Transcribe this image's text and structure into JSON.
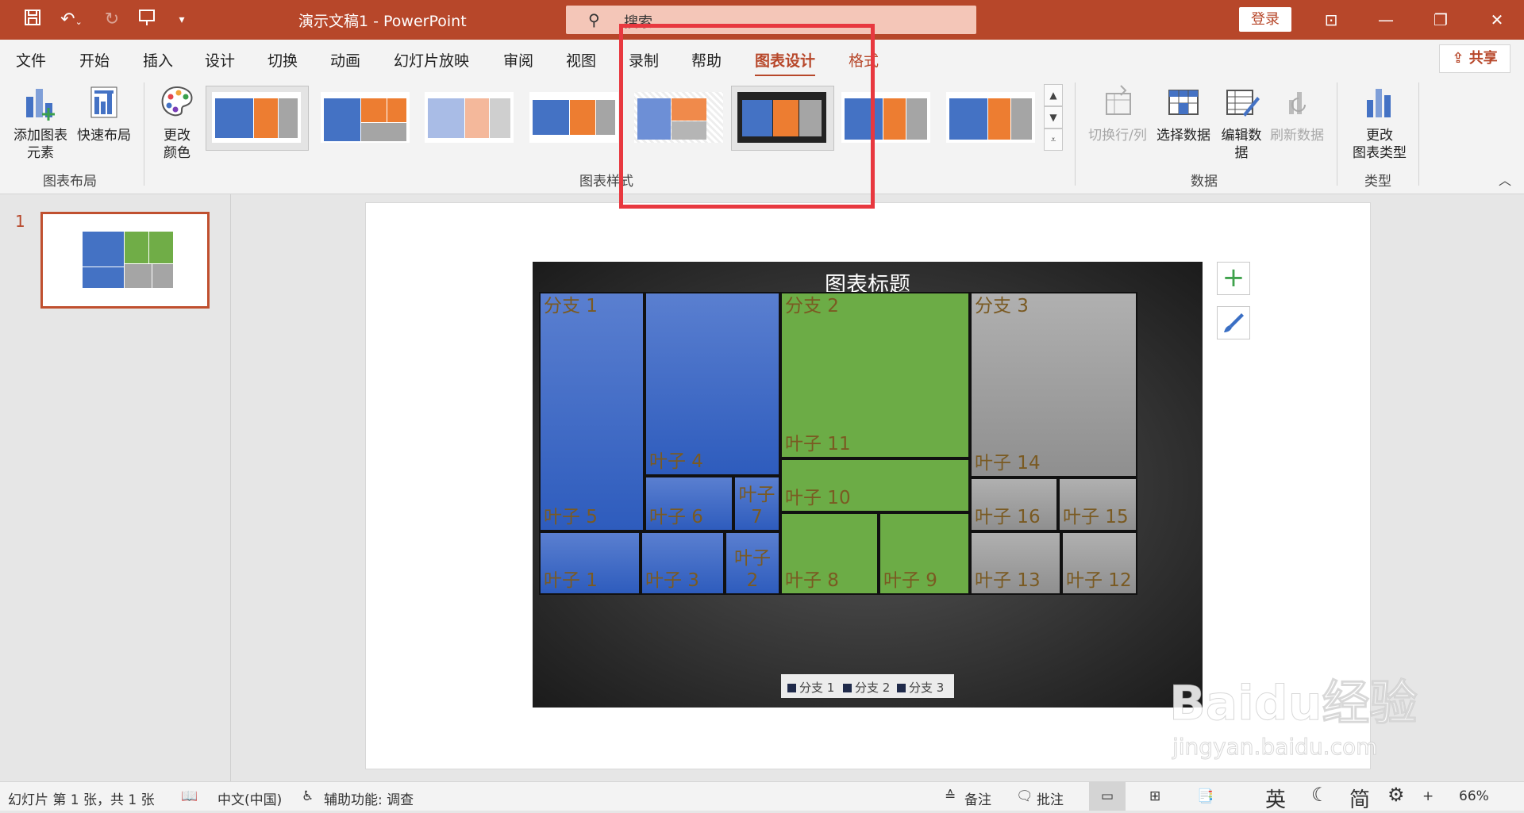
{
  "window": {
    "doc_title": "演示文稿1  -  PowerPoint",
    "search_placeholder": "搜索",
    "login_label": "登录"
  },
  "menu": {
    "tabs": [
      "文件",
      "开始",
      "插入",
      "设计",
      "切换",
      "动画",
      "幻灯片放映",
      "审阅",
      "视图",
      "录制",
      "帮助",
      "图表设计",
      "格式"
    ],
    "active_tab": "图表设计",
    "share_label": "共享"
  },
  "ribbon": {
    "add_element": "添加图表\n元素",
    "quick_layout": "快速布局",
    "change_color": "更改\n颜色",
    "group_layout": "图表布局",
    "group_styles": "图表样式",
    "switch_row_col": "切换行/列",
    "select_data": "选择数据",
    "edit_data": "编辑数\n据",
    "refresh_data": "刷新数据",
    "group_data": "数据",
    "change_type": "更改\n图表类型",
    "group_type": "类型"
  },
  "thumbs": {
    "slide_number": "1"
  },
  "chart_data": {
    "type": "treemap",
    "title": "图表标题",
    "branches": [
      {
        "name": "分支 1",
        "leaves": [
          "叶子 5",
          "叶子 4",
          "叶子 6",
          "叶子 7",
          "叶子 1",
          "叶子 3",
          "叶子 2"
        ]
      },
      {
        "name": "分支 2",
        "leaves": [
          "叶子 11",
          "叶子 10",
          "叶子 8",
          "叶子 9"
        ]
      },
      {
        "name": "分支 3",
        "leaves": [
          "叶子 14",
          "叶子 16",
          "叶子 15",
          "叶子 13",
          "叶子 12"
        ]
      }
    ],
    "legend": [
      "分支 1",
      "分支 2",
      "分支 3"
    ],
    "colors": {
      "branch1": "#3d6bc9",
      "branch2": "#6cac46",
      "branch3": "#9e9e9e"
    }
  },
  "watermark": {
    "logo": "Baidu经验",
    "sub": "jingyan.baidu.com"
  },
  "status": {
    "slide_info": "幻灯片 第 1 张，共 1 张",
    "language": "中文(中国)",
    "accessibility": "辅助功能: 调查",
    "notes": "备注",
    "comments": "批注",
    "ime_en": "英",
    "ime_simp": "简",
    "zoom": "66%"
  }
}
